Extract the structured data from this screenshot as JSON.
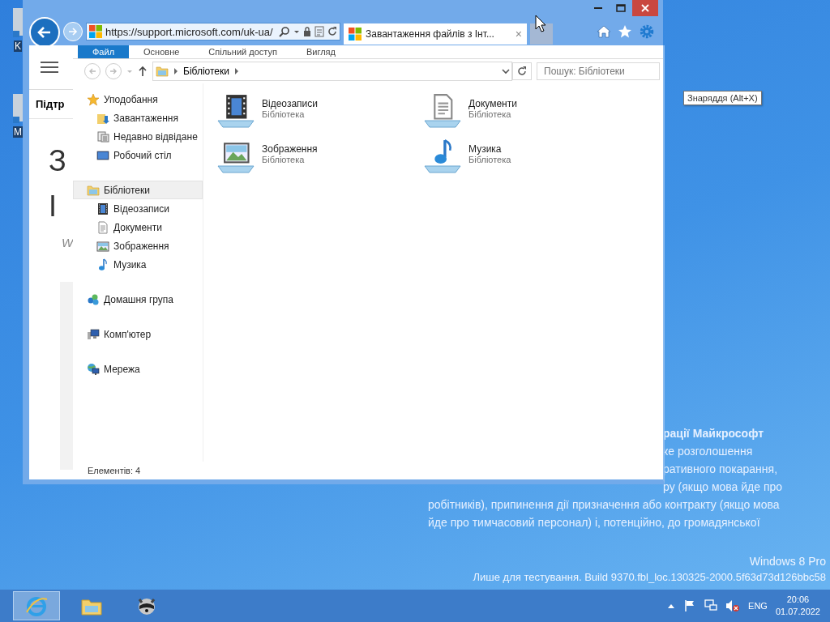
{
  "desktop_icons": [
    {
      "label": "K"
    },
    {
      "label": "M"
    }
  ],
  "browser": {
    "url": "https://support.microsoft.com/uk-ua/",
    "tabs": [
      {
        "title": "Завантаження файлів з Інт...",
        "close": "×",
        "selected": true
      }
    ],
    "page": [
      {
        "kind": "header",
        "text": "Підтр"
      },
      {
        "kind": "big",
        "text": "З"
      },
      {
        "kind": "big",
        "text": "І"
      },
      {
        "kind": "note",
        "text": "W"
      }
    ]
  },
  "explorer": {
    "ribbon_tabs": [
      {
        "label": "Файл",
        "selected": true
      },
      {
        "label": "Основне",
        "selected": false
      },
      {
        "label": "Спільний доступ",
        "selected": false
      },
      {
        "label": "Вигляд",
        "selected": false
      }
    ],
    "address": {
      "path": [
        "Бібліотеки"
      ]
    },
    "search": {
      "placeholder": "Пошук: Бібліотеки"
    },
    "navigation": [
      {
        "label": "Уподобання",
        "kind": "favorites",
        "selected": false,
        "children": [
          {
            "label": "Завантаження",
            "kind": "downloads",
            "selected": false
          },
          {
            "label": "Недавно відвідане",
            "kind": "recent",
            "selected": false
          },
          {
            "label": "Робочий стіл",
            "kind": "desktop",
            "selected": false
          }
        ]
      },
      {
        "label": "Бібліотеки",
        "kind": "libraries",
        "selected": true,
        "children": [
          {
            "label": "Відеозаписи",
            "kind": "videos",
            "selected": false
          },
          {
            "label": "Документи",
            "kind": "documents",
            "selected": false
          },
          {
            "label": "Зображення",
            "kind": "pictures",
            "selected": false
          },
          {
            "label": "Музика",
            "kind": "music",
            "selected": false
          }
        ]
      },
      {
        "label": "Домашня група",
        "kind": "homegroup",
        "selected": false
      },
      {
        "label": "Комп'ютер",
        "kind": "computer",
        "selected": false
      },
      {
        "label": "Мережа",
        "kind": "network",
        "selected": false
      }
    ],
    "items": [
      {
        "name": "Відеозаписи",
        "type": "Бібліотека",
        "kind": "videos"
      },
      {
        "name": "Документи",
        "type": "Бібліотека",
        "kind": "documents"
      },
      {
        "name": "Зображення",
        "type": "Бібліотека",
        "kind": "pictures"
      },
      {
        "name": "Музика",
        "type": "Бібліотека",
        "kind": "music"
      }
    ],
    "status": "Елементів: 4"
  },
  "tooltip": {
    "text": "Знаряддя (Alt+X)"
  },
  "desktop_notice": {
    "lines": [
      {
        "text": "рації Майкрософт",
        "kind": "clipped",
        "bold": true
      },
      {
        "text": "ке розголошення",
        "kind": "clipped",
        "bold": false
      },
      {
        "text": "ративного покарання,",
        "kind": "clipped",
        "bold": false
      },
      {
        "text": "ру (якщо мова йде про",
        "kind": "clipped",
        "bold": false
      },
      {
        "text": "робітників), припинення дії призначення або контракту (якщо мова",
        "kind": "full",
        "bold": false
      },
      {
        "text": "йде про тимчасовий персонал) і, потенційно, до громадянської",
        "kind": "full",
        "bold": false
      }
    ]
  },
  "os_edition": {
    "edition": "Windows 8 Pro",
    "build": "Лише для тестування. Build 9370.fbl_loc.130325-2000.5f63d73d126bbc58"
  },
  "taskbar": {
    "apps": [
      {
        "kind": "browser",
        "selected": true
      },
      {
        "kind": "folder",
        "selected": false
      },
      {
        "kind": "raccoon",
        "selected": false
      }
    ],
    "tray": {
      "language": "ENG",
      "time": "20:06",
      "date": "01.07.2022"
    }
  }
}
